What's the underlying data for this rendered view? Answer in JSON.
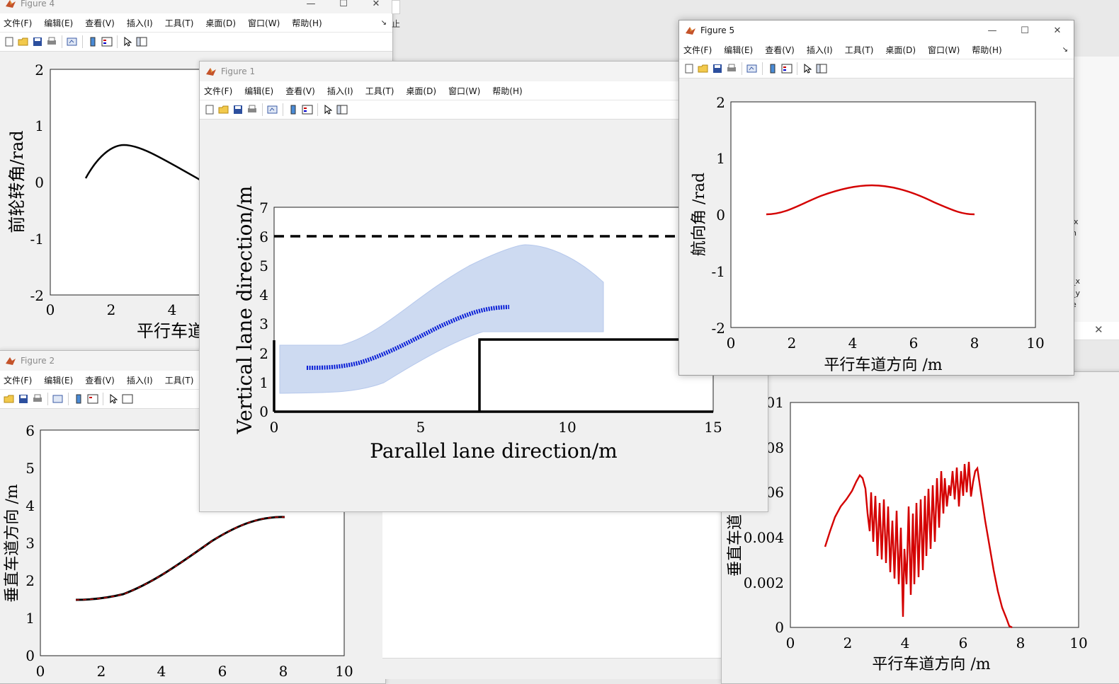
{
  "menu": [
    "文件(F)",
    "编辑(E)",
    "查看(V)",
    "插入(I)",
    "工具(T)",
    "桌面(D)",
    "窗口(W)",
    "帮助(H)"
  ],
  "menu_partial": [
    "文件(F)",
    "编辑(E)",
    "查看(V)",
    "插入(I)",
    "工具(T)",
    "桌"
  ],
  "colors": {
    "red": "#d40000",
    "blue": "#0a1fd6",
    "envelope": "#c8d6f0",
    "black": "#000000"
  },
  "figure4": {
    "title": "Figure 4",
    "menu_overflow": "止",
    "chart_data": {
      "type": "line",
      "ylabel": "前轮转角/rad",
      "xlabel_visible": "平行车道",
      "ylim": [
        -2,
        2
      ],
      "xlim_visible": [
        0,
        5
      ],
      "yticks": [
        "2",
        "1",
        "0",
        "-1",
        "-2"
      ],
      "xticks": [
        "0",
        "2",
        "4"
      ],
      "series": [
        {
          "color": "#000000",
          "x": [
            1.2,
            1.5,
            1.9,
            2.2,
            2.5,
            2.9,
            3.3,
            3.8,
            4.3,
            4.9
          ],
          "y": [
            0.05,
            0.3,
            0.45,
            0.5,
            0.52,
            0.48,
            0.38,
            0.25,
            0.12,
            -0.08
          ]
        }
      ]
    }
  },
  "figure2": {
    "title": "Figure 2",
    "chart_data": {
      "type": "line",
      "ylabel": "垂直车道方向 /m",
      "ylim": [
        0,
        6
      ],
      "xlim": [
        0,
        10
      ],
      "yticks": [
        "6",
        "5",
        "4",
        "3",
        "2",
        "1",
        "0"
      ],
      "xticks": [
        "0",
        "2",
        "4",
        "6",
        "8",
        "10"
      ],
      "series": [
        {
          "color": "#000000",
          "style": "red-dashed-overlay",
          "x": [
            1.2,
            2.0,
            3.0,
            4.0,
            5.0,
            6.0,
            6.5,
            7.0,
            7.5,
            8.0
          ],
          "y": [
            1.5,
            1.55,
            1.9,
            2.4,
            2.95,
            3.4,
            3.53,
            3.6,
            3.62,
            3.62
          ]
        }
      ]
    }
  },
  "figure1": {
    "title": "Figure 1",
    "chart_data": {
      "type": "line",
      "xlabel": "Parallel lane direction/m",
      "ylabel": "Vertical lane direction/m",
      "xlim": [
        0,
        15
      ],
      "ylim": [
        0,
        7
      ],
      "xticks": [
        "0",
        "5",
        "10",
        "15"
      ],
      "yticks": [
        "7",
        "6",
        "5",
        "4",
        "3",
        "2",
        "1",
        "0"
      ],
      "lane_line_y": 6,
      "parked_box": {
        "x_start": 7,
        "height": 2.5
      },
      "path": {
        "x": [
          1.2,
          2.0,
          3.0,
          4.0,
          5.0,
          6.0,
          7.0,
          8.0
        ],
        "y": [
          1.5,
          1.56,
          1.9,
          2.45,
          3.05,
          3.45,
          3.6,
          3.62
        ]
      },
      "envelope": {
        "x": [
          0.2,
          2.0,
          4.0,
          6.0,
          8.5,
          10.0,
          11.3,
          11.3,
          10.0,
          8.0,
          6.0,
          4.0,
          2.0,
          0.2
        ],
        "y": [
          2.3,
          2.3,
          3.0,
          4.3,
          5.25,
          5.0,
          4.5,
          2.8,
          2.8,
          2.9,
          2.2,
          1.3,
          0.7,
          0.65
        ]
      }
    }
  },
  "figure5": {
    "title": "Figure 5",
    "chart_data": {
      "type": "line",
      "xlabel": "平行车道方向 /m",
      "ylabel": "航向角 /rad",
      "xlim": [
        0,
        10
      ],
      "ylim": [
        -2,
        2
      ],
      "xticks": [
        "0",
        "2",
        "4",
        "6",
        "8",
        "10"
      ],
      "yticks": [
        "2",
        "1",
        "0",
        "-1",
        "-2"
      ],
      "series": [
        {
          "color": "#d40000",
          "x": [
            1.2,
            2.0,
            3.0,
            4.0,
            4.6,
            5.5,
            6.5,
            7.5,
            8.0
          ],
          "y": [
            0.0,
            0.1,
            0.35,
            0.5,
            0.52,
            0.47,
            0.3,
            0.08,
            0.0
          ]
        }
      ]
    }
  },
  "figure3": {
    "chart_data": {
      "type": "line",
      "xlabel": "平行车道方向 /m",
      "ylabel_visible": "垂直车道",
      "xlim": [
        0,
        10
      ],
      "ylim": [
        0,
        0.01
      ],
      "xticks": [
        "0",
        "2",
        "4",
        "6",
        "8",
        "10"
      ],
      "yticks": [
        "01",
        "08",
        "06",
        "0.004",
        "0.002",
        "0"
      ],
      "series": [
        {
          "color": "#d40000",
          "x": [
            1.2,
            1.6,
            2.0,
            2.4,
            2.6,
            3.0,
            3.5,
            3.9,
            4.0,
            4.5,
            5.0,
            5.5,
            6.0,
            6.3,
            6.6,
            7.0,
            7.5,
            8.0
          ],
          "y": [
            0.0036,
            0.005,
            0.0057,
            0.0067,
            0.0065,
            0.004,
            0.003,
            0.002,
            0.0005,
            0.003,
            0.0045,
            0.0055,
            0.0068,
            0.0072,
            0.007,
            0.0045,
            0.0015,
            0.0
          ]
        }
      ]
    }
  },
  "side_fragments": [
    "x",
    "n",
    "_x",
    "_y",
    "e"
  ]
}
